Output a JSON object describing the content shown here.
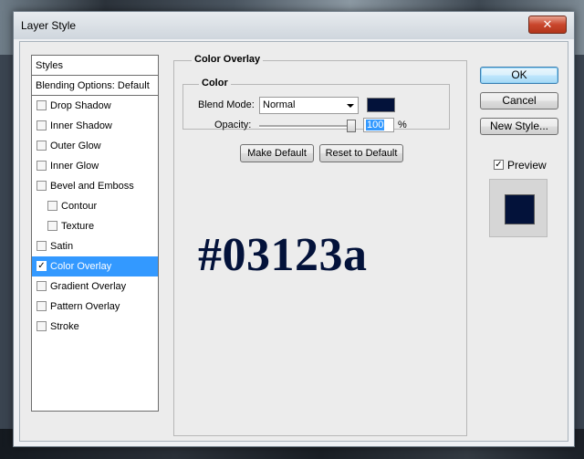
{
  "window": {
    "title": "Layer Style",
    "close_glyph": "✕"
  },
  "styles_list": {
    "header": "Styles",
    "blending": "Blending Options: Default",
    "items": [
      {
        "label": "Drop Shadow",
        "checked": false,
        "indent": false,
        "selected": false
      },
      {
        "label": "Inner Shadow",
        "checked": false,
        "indent": false,
        "selected": false
      },
      {
        "label": "Outer Glow",
        "checked": false,
        "indent": false,
        "selected": false
      },
      {
        "label": "Inner Glow",
        "checked": false,
        "indent": false,
        "selected": false
      },
      {
        "label": "Bevel and Emboss",
        "checked": false,
        "indent": false,
        "selected": false
      },
      {
        "label": "Contour",
        "checked": false,
        "indent": true,
        "selected": false
      },
      {
        "label": "Texture",
        "checked": false,
        "indent": true,
        "selected": false
      },
      {
        "label": "Satin",
        "checked": false,
        "indent": false,
        "selected": false
      },
      {
        "label": "Color Overlay",
        "checked": true,
        "indent": false,
        "selected": true
      },
      {
        "label": "Gradient Overlay",
        "checked": false,
        "indent": false,
        "selected": false
      },
      {
        "label": "Pattern Overlay",
        "checked": false,
        "indent": false,
        "selected": false
      },
      {
        "label": "Stroke",
        "checked": false,
        "indent": false,
        "selected": false
      }
    ]
  },
  "color_overlay": {
    "group_title": "Color Overlay",
    "inner_title": "Color",
    "blend_mode_label": "Blend Mode:",
    "blend_mode_value": "Normal",
    "swatch_color": "#03123a",
    "opacity_label": "Opacity:",
    "opacity_value": "100",
    "opacity_unit": "%",
    "opacity_level": 1.0,
    "make_default": "Make Default",
    "reset_default": "Reset to Default"
  },
  "overlay_text": "#03123a",
  "side_buttons": {
    "ok": "OK",
    "cancel": "Cancel",
    "new_style": "New Style...",
    "preview_label": "Preview",
    "preview_checked": true
  },
  "colors": {
    "selection": "#3399ff",
    "overlay": "#03123a"
  }
}
